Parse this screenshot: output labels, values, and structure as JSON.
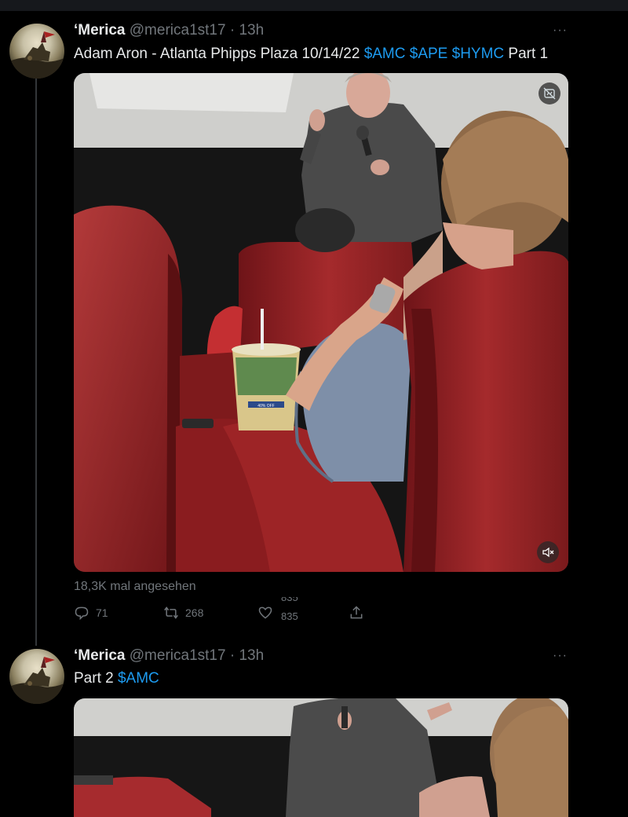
{
  "tweets": [
    {
      "author_name": "‘Merica",
      "handle": "@merica1st17",
      "separator": "·",
      "time": "13h",
      "more_label": "···",
      "text_prefix": "Adam Aron - Atlanta Phipps Plaza 10/14/22 ",
      "cashtags": [
        "$AMC",
        "$APE",
        "$HYMC"
      ],
      "text_suffix": " Part 1",
      "cup_text": "40% OFF",
      "views": "18,3K mal angesehen",
      "replies": "71",
      "retweets": "268",
      "likes_old": "835",
      "likes_new": "835"
    },
    {
      "author_name": "‘Merica",
      "handle": "@merica1st17",
      "separator": "·",
      "time": "13h",
      "more_label": "···",
      "text_prefix": "Part 2 ",
      "cashtags": [
        "$AMC"
      ]
    }
  ],
  "icons": {
    "reply": "speech-bubble-icon",
    "retweet": "retweet-icon",
    "like": "heart-icon",
    "share": "share-icon",
    "mute": "speaker-muted-icon",
    "media": "media-settings-icon"
  },
  "colors": {
    "background": "#000000",
    "text": "#e7e9ea",
    "secondary": "#71767b",
    "link": "#1d9bf0",
    "seat_red": "#8f1c1f"
  }
}
